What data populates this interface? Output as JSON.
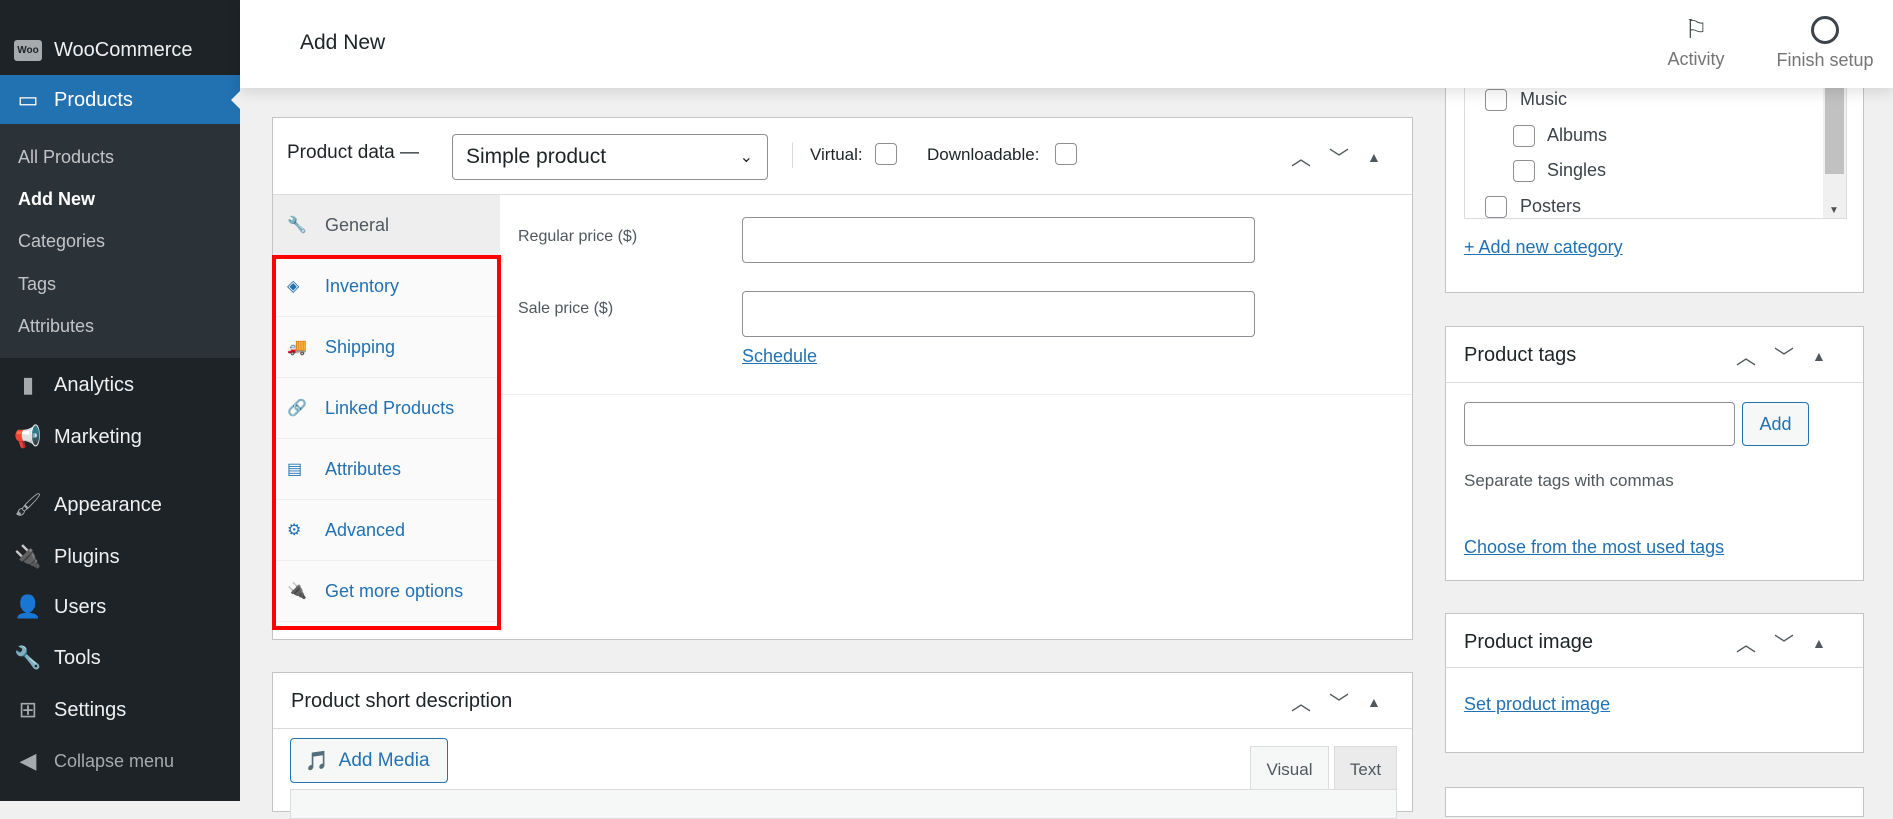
{
  "sidebar": {
    "woocommerce": "WooCommerce",
    "products": "Products",
    "submenu": [
      "All Products",
      "Add New",
      "Categories",
      "Tags",
      "Attributes"
    ],
    "items": [
      "Analytics",
      "Marketing",
      "Appearance",
      "Plugins",
      "Users",
      "Tools",
      "Settings"
    ],
    "collapse": "Collapse menu"
  },
  "header": {
    "title": "Add New",
    "activity": "Activity",
    "finish_setup": "Finish setup"
  },
  "product_data": {
    "title": "Product data —",
    "type_select": "Simple product",
    "virtual_label": "Virtual:",
    "downloadable_label": "Downloadable:",
    "virtual_checked": false,
    "downloadable_checked": false,
    "tabs": [
      "General",
      "Inventory",
      "Shipping",
      "Linked Products",
      "Attributes",
      "Advanced",
      "Get more options"
    ],
    "active_tab": "General",
    "regular_price_label": "Regular price ($)",
    "regular_price_value": "",
    "sale_price_label": "Sale price ($)",
    "sale_price_value": "",
    "schedule_link": "Schedule",
    "highlight_color": "#ff0000"
  },
  "short_description": {
    "title": "Product short description",
    "add_media": "Add Media",
    "visual_tab": "Visual",
    "text_tab": "Text"
  },
  "categories": {
    "items": [
      {
        "label": "Music",
        "level": 0
      },
      {
        "label": "Albums",
        "level": 1
      },
      {
        "label": "Singles",
        "level": 1
      },
      {
        "label": "Posters",
        "level": 0
      }
    ],
    "add_new": "+ Add new category"
  },
  "product_tags": {
    "title": "Product tags",
    "input_value": "",
    "add_button": "Add",
    "hint": "Separate tags with commas",
    "choose_link": "Choose from the most used tags"
  },
  "product_image": {
    "title": "Product image",
    "set_link": "Set product image"
  }
}
